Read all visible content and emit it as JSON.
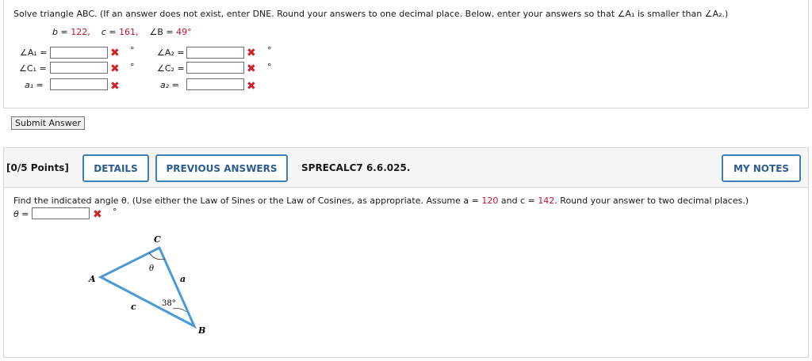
{
  "problem1": {
    "instructions": "Solve triangle ABC. (If an answer does not exist, enter DNE. Round your answers to one decimal place. Below, enter your answers so that ∠A₁ is smaller than ∠A₂.)",
    "given_b_label": "b = ",
    "given_b_value": "122,",
    "given_c_label": "c = ",
    "given_c_value": "161,",
    "given_B_label": "∠B = ",
    "given_B_value": "49°",
    "fields": {
      "A1": {
        "label": "∠A₁ =",
        "value": "",
        "unit": "°"
      },
      "C1": {
        "label": "∠C₁ =",
        "value": "",
        "unit": "°"
      },
      "a1": {
        "label": "a₁ =",
        "value": ""
      },
      "A2": {
        "label": "∠A₂ =",
        "value": "",
        "unit": "°"
      },
      "C2": {
        "label": "∠C₂ =",
        "value": "",
        "unit": "°"
      },
      "a2": {
        "label": "a₂ =",
        "value": ""
      }
    },
    "incorrect_mark": "✖",
    "submit_label": "Submit Answer"
  },
  "problem2": {
    "points": "[0/5 Points]",
    "details_label": "DETAILS",
    "previous_answers_label": "PREVIOUS ANSWERS",
    "problem_id": "SPRECALC7 6.6.025.",
    "my_notes_label": "MY NOTES",
    "instructions_pre": "Find the indicated angle θ. (Use either the Law of Sines or the Law of Cosines, as appropriate. Assume a = ",
    "a_value": "120",
    "instructions_mid": " and c = ",
    "c_value": "142",
    "instructions_post": ". Round your answer to two decimal places.)",
    "theta_label": "θ =",
    "theta_value": "",
    "theta_unit": "°",
    "incorrect_mark": "✖",
    "figure": {
      "vertex_A": "A",
      "vertex_B": "B",
      "vertex_C": "C",
      "side_a": "a",
      "side_c": "c",
      "angle_theta": "θ",
      "angle_B": "38°",
      "line_color": "#4a9ad9"
    }
  }
}
